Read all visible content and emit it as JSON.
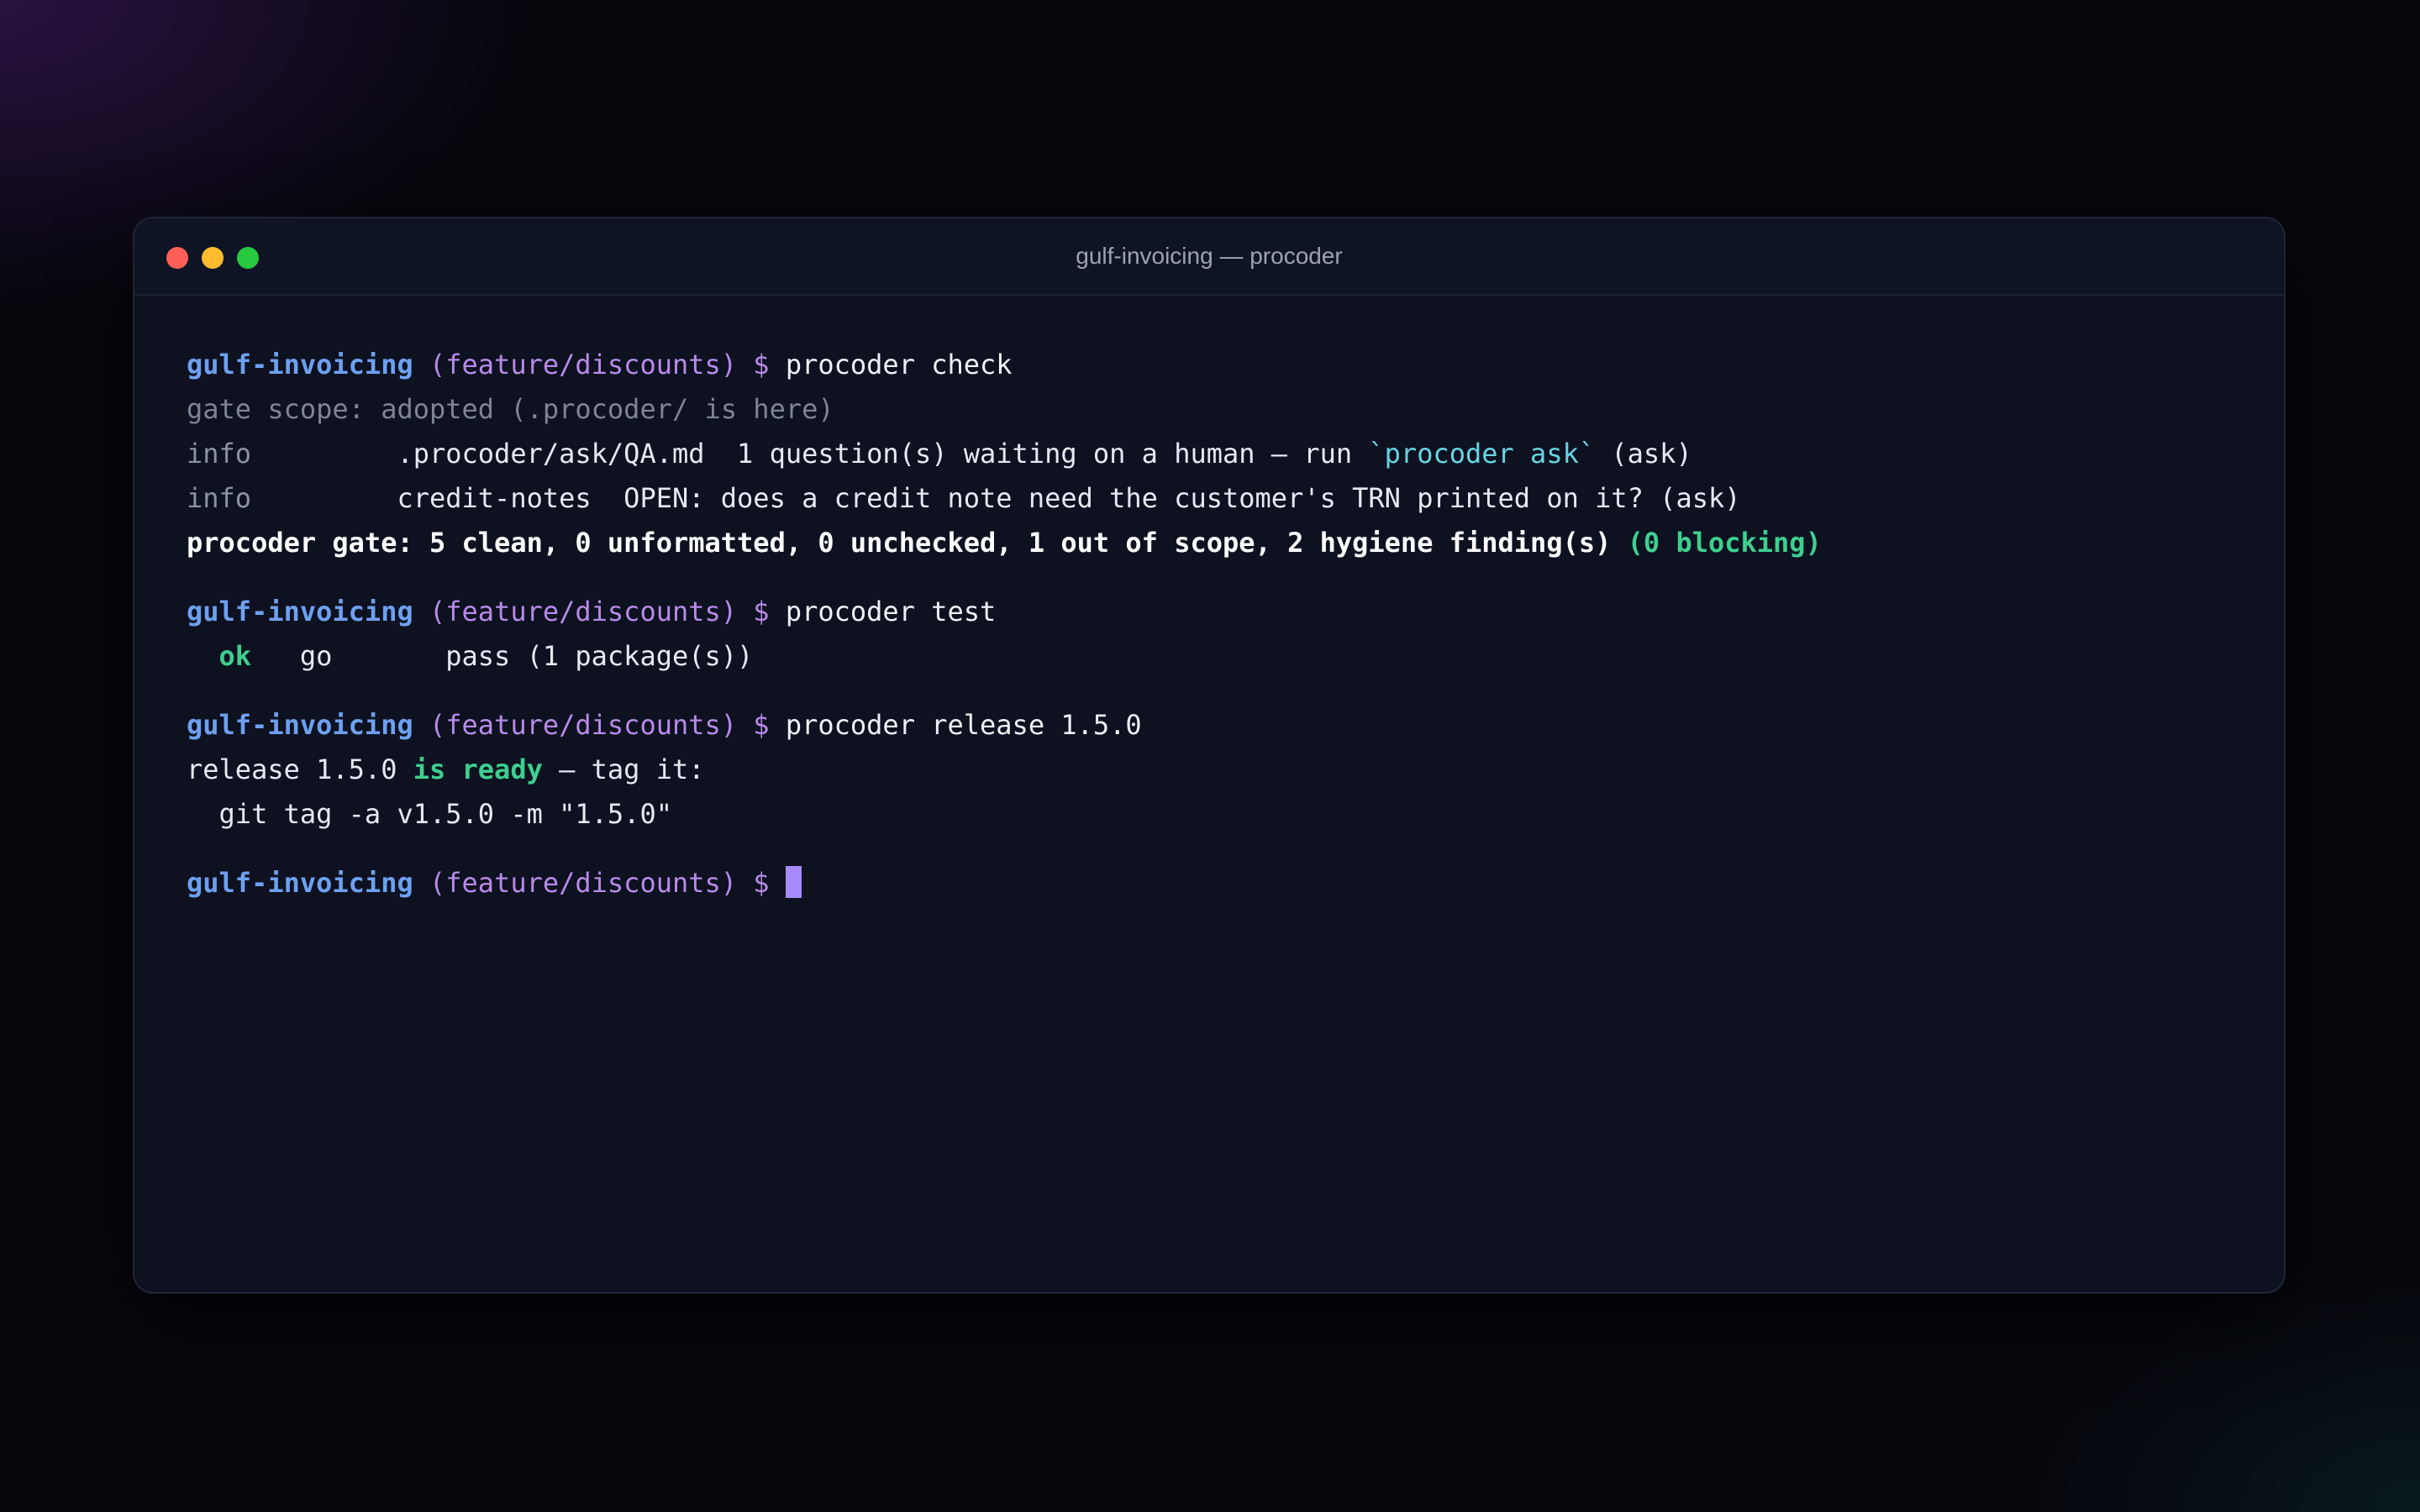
{
  "window": {
    "title": "gulf-invoicing — procoder"
  },
  "prompt": {
    "dir": "gulf-invoicing",
    "branch": "(feature/discounts)",
    "symbol": "$"
  },
  "blocks": {
    "check": {
      "command": "procoder check",
      "scope": "gate scope: adopted (.procoder/ is here)",
      "info1": {
        "level": "info",
        "path": ".procoder/ask/QA.md",
        "msg_pre": "1 question(s) waiting on a human — run",
        "msg_cmd": "`procoder ask`",
        "msg_post": "(ask)"
      },
      "info2": {
        "level": "info",
        "path": "credit-notes",
        "msg": "OPEN: does a credit note need the customer's TRN printed on it? (ask)"
      },
      "summary": "procoder gate: 5 clean, 0 unformatted, 0 unchecked, 1 out of scope, 2 hygiene finding(s)",
      "summary_status": "(0 blocking)"
    },
    "test": {
      "command": "procoder test",
      "status": "ok",
      "lang": "go",
      "result": "pass (1 package(s))"
    },
    "release": {
      "command": "procoder release 1.5.0",
      "msg_pre": "release 1.5.0",
      "msg_status": "is ready",
      "msg_post": "— tag it:",
      "git_command": "git tag -a v1.5.0 -m \"1.5.0\""
    }
  },
  "colors": {
    "accent_cursor": "#a78bfa",
    "dir": "#6ea0f0",
    "branch": "#b88ae8",
    "success": "#3ecf8e",
    "code": "#67d5e3"
  }
}
